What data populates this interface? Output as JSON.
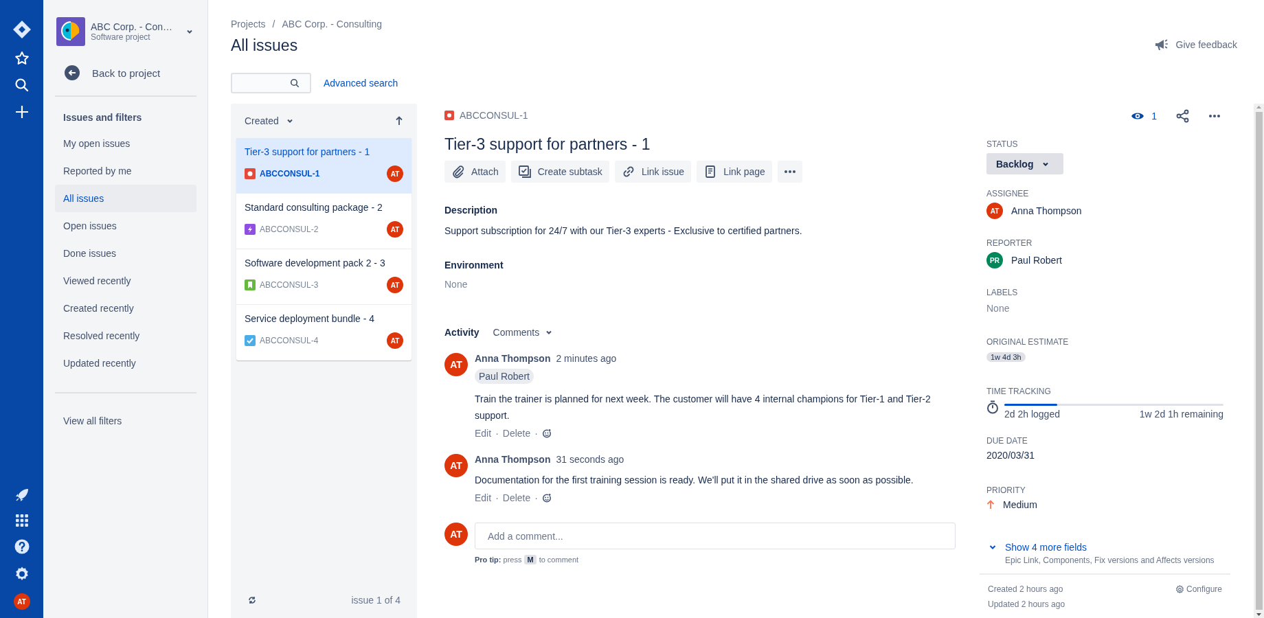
{
  "global_nav": {
    "avatar": "AT"
  },
  "sidebar": {
    "project": {
      "name": "ABC Corp. - Con…",
      "type": "Software project"
    },
    "back": "Back to project",
    "section": "Issues and filters",
    "items": [
      {
        "label": "My open issues",
        "selected": false
      },
      {
        "label": "Reported by me",
        "selected": false
      },
      {
        "label": "All issues",
        "selected": true
      },
      {
        "label": "Open issues",
        "selected": false
      },
      {
        "label": "Done issues",
        "selected": false
      },
      {
        "label": "Viewed recently",
        "selected": false
      },
      {
        "label": "Created recently",
        "selected": false
      },
      {
        "label": "Resolved recently",
        "selected": false
      },
      {
        "label": "Updated recently",
        "selected": false
      }
    ],
    "footer_link": "View all filters"
  },
  "breadcrumbs": [
    "Projects",
    "/",
    "ABC Corp. - Consulting"
  ],
  "page_title": "All issues",
  "feedback": "Give feedback",
  "advanced_search": "Advanced search",
  "issue_list": {
    "sort": "Created",
    "footer": "issue 1 of 4",
    "issues": [
      {
        "title": "Tier-3 support for partners - 1",
        "key": "ABCCONSUL-1",
        "kind": "bug",
        "assignee": "AT",
        "selected": true
      },
      {
        "title": "Standard consulting package - 2",
        "key": "ABCCONSUL-2",
        "kind": "epic",
        "assignee": "AT",
        "selected": false
      },
      {
        "title": "Software development pack 2 - 3",
        "key": "ABCCONSUL-3",
        "kind": "story",
        "assignee": "AT",
        "selected": false
      },
      {
        "title": "Service deployment bundle - 4",
        "key": "ABCCONSUL-4",
        "kind": "task",
        "assignee": "AT",
        "selected": false
      }
    ]
  },
  "detail": {
    "key": "ABCCONSUL-1",
    "kind": "bug",
    "title": "Tier-3 support for partners - 1",
    "watchers": "1",
    "actions": [
      {
        "kind": "attach",
        "label": "Attach"
      },
      {
        "kind": "subtask",
        "label": "Create subtask"
      },
      {
        "kind": "link",
        "label": "Link issue"
      },
      {
        "kind": "page",
        "label": "Link page"
      },
      {
        "kind": "more"
      }
    ],
    "description_label": "Description",
    "description": "Support subscription for 24/7 with our Tier-3 experts - Exclusive to certified partners.",
    "environment_label": "Environment",
    "environment": "None",
    "activity_label": "Activity",
    "activity_filter": "Comments",
    "comments": [
      {
        "avatar": "AT",
        "author": "Anna Thompson",
        "time": "2 minutes ago",
        "mention": "Paul Robert",
        "text": "Train the trainer is planned for next week. The customer will have 4 internal champions for Tier-1 and Tier-2 support.",
        "actions": [
          {
            "kind": "link",
            "label": "Edit"
          },
          {
            "kind": "sep",
            "label": "·"
          },
          {
            "kind": "link",
            "label": "Delete"
          },
          {
            "kind": "sep",
            "label": "·"
          },
          {
            "kind": "react"
          }
        ]
      },
      {
        "avatar": "AT",
        "author": "Anna Thompson",
        "time": "31 seconds ago",
        "text": "Documentation for the first training session is ready. We'll put it in the shared drive as soon as possible.",
        "actions": [
          {
            "kind": "link",
            "label": "Edit"
          },
          {
            "kind": "sep",
            "label": "·"
          },
          {
            "kind": "link",
            "label": "Delete"
          },
          {
            "kind": "sep",
            "label": "·"
          },
          {
            "kind": "react"
          }
        ]
      }
    ],
    "composer": {
      "avatar": "AT",
      "placeholder": "Add a comment..."
    },
    "pro_tip": [
      "**Pro tip:** press",
      "M",
      "to comment"
    ]
  },
  "fields": [
    {
      "kind": "status",
      "label": "STATUS",
      "value": "Backlog"
    },
    {
      "kind": "user",
      "label": "ASSIGNEE",
      "initials": "AT",
      "value": "Anna Thompson",
      "color": "#de350b"
    },
    {
      "kind": "user",
      "label": "REPORTER",
      "initials": "PR",
      "value": "Paul Robert",
      "color": "#00875a"
    },
    {
      "kind": "empty",
      "label": "LABELS",
      "value": "None"
    },
    {
      "kind": "chip",
      "label": "ORIGINAL ESTIMATE",
      "value": "1w 4d 3h"
    },
    {
      "kind": "tracking",
      "label": "TIME TRACKING",
      "level": 0.24,
      "logged": "2d 2h logged",
      "remaining": "1w 2d 1h remaining"
    },
    {
      "kind": "text",
      "label": "DUE DATE",
      "value": "2020/03/31"
    },
    {
      "kind": "priority",
      "label": "PRIORITY",
      "value": "Medium"
    }
  ],
  "more_fields": {
    "label": "Show 4 more fields",
    "hint": "Epic Link, Components, Fix versions and Affects versions"
  },
  "meta": {
    "created": "Created 2 hours ago",
    "updated": "Updated 2 hours ago",
    "configure": "Configure"
  }
}
